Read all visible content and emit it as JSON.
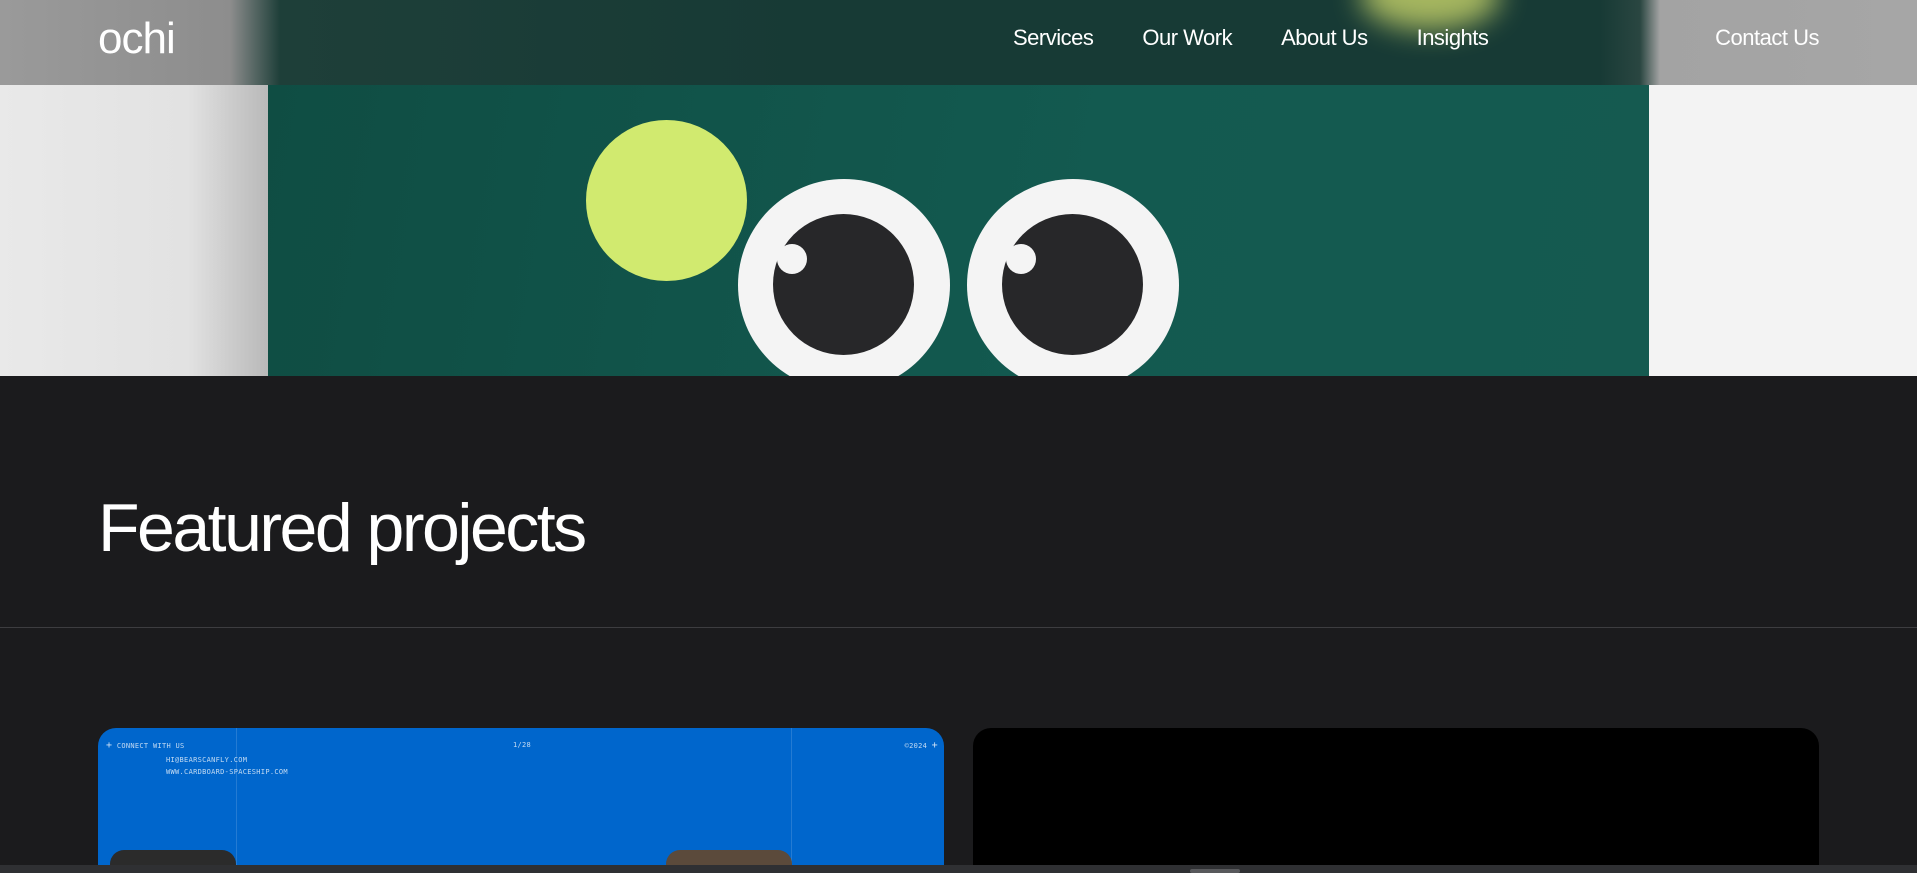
{
  "nav": {
    "logo": "ochi",
    "links": [
      "Services",
      "Our Work",
      "About Us",
      "Insights"
    ],
    "contact": "Contact Us"
  },
  "hero": {
    "colors": {
      "center": "#135a50",
      "ball": "#d1ea6f",
      "eye": "#f4f4f4",
      "pupil": "#272729"
    }
  },
  "featured": {
    "title": "Featured projects"
  },
  "cards": [
    {
      "background": "#0066cc",
      "top_left": "CONNECT WITH US",
      "center": "1/28",
      "top_right": "©2024",
      "email": "HI@BEARSCANFLY.COM",
      "website": "WWW.CARDBOARD-SPACESHIP.COM"
    },
    {
      "background": "#000000"
    }
  ]
}
